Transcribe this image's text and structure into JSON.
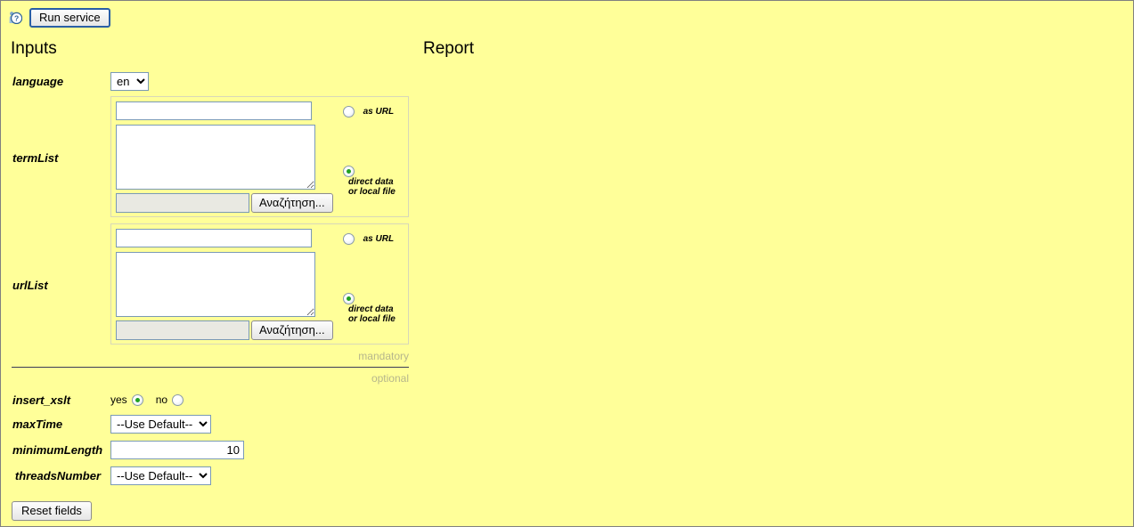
{
  "page": {
    "background_color": "#ffff99",
    "border_color": "#808080"
  },
  "toolbar": {
    "info_icon": "info-person-icon",
    "run_label": "Run service"
  },
  "headings": {
    "inputs": "Inputs",
    "report": "Report"
  },
  "mandatory": {
    "tag": "mandatory",
    "params": [
      {
        "name": "language",
        "type": "select",
        "value": "en",
        "options": [
          "en"
        ]
      },
      {
        "name": "termList",
        "type": "compound",
        "url_value": "",
        "data_value": "",
        "file_value": "",
        "browse_label": "Αναζήτηση...",
        "mode_options": [
          {
            "label": "as URL",
            "selected": false
          },
          {
            "label": "direct data or local file",
            "selected": true
          }
        ]
      },
      {
        "name": "urlList",
        "type": "compound",
        "url_value": "",
        "data_value": "",
        "file_value": "",
        "browse_label": "Αναζήτηση...",
        "mode_options": [
          {
            "label": "as URL",
            "selected": false
          },
          {
            "label": "direct data or local file",
            "selected": true
          }
        ]
      }
    ]
  },
  "optional": {
    "tag": "optional",
    "params": [
      {
        "name": "insert_xslt",
        "type": "radio",
        "yes_label": "yes",
        "no_label": "no",
        "yes_selected": true,
        "no_selected": false
      },
      {
        "name": "maxTime",
        "type": "select",
        "value": "--Use Default--",
        "options": [
          "--Use Default--"
        ]
      },
      {
        "name": "minimumLength",
        "type": "text",
        "value": "10"
      },
      {
        "name": "threadsNumber",
        "type": "select",
        "value": "--Use Default--",
        "options": [
          "--Use Default--"
        ]
      }
    ]
  },
  "footer": {
    "reset_label": "Reset fields"
  }
}
